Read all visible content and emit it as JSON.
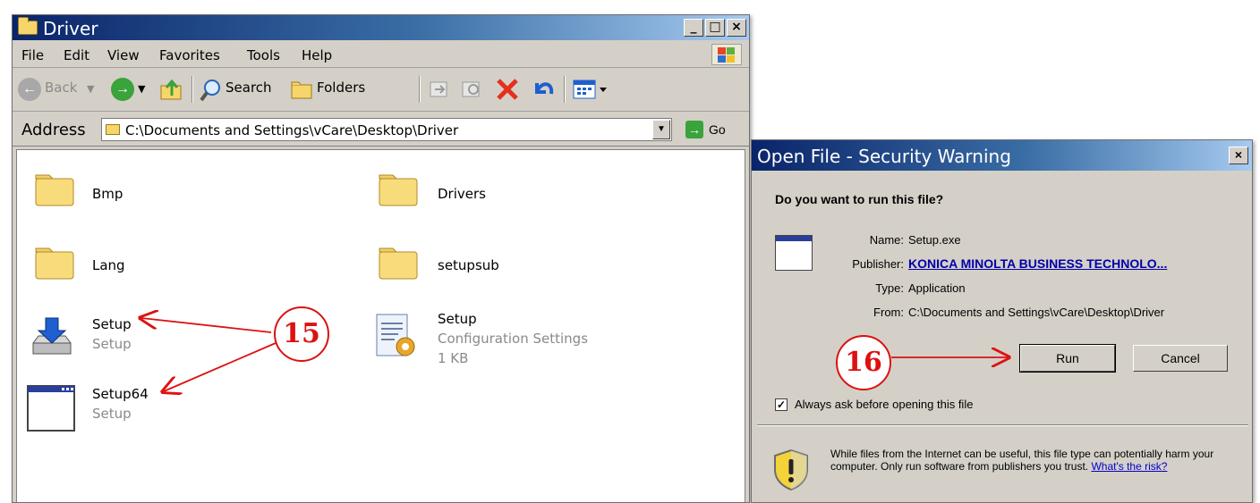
{
  "explorer": {
    "title": "Driver",
    "window_buttons": {
      "minimize": "_",
      "maximize": "□",
      "close": "×"
    },
    "menu": [
      "File",
      "Edit",
      "View",
      "Favorites",
      "Tools",
      "Help"
    ],
    "toolbar": {
      "back_label": "Back",
      "search_label": "Search",
      "folders_label": "Folders"
    },
    "address": {
      "label": "Address",
      "path": "C:\\Documents and Settings\\vCare\\Desktop\\Driver",
      "go_label": "Go"
    },
    "items": [
      {
        "name": "Bmp",
        "icon": "folder-icon"
      },
      {
        "name": "Drivers",
        "icon": "folder-icon"
      },
      {
        "name": "Lang",
        "icon": "folder-icon"
      },
      {
        "name": "setupsub",
        "icon": "folder-icon"
      },
      {
        "name": "Setup",
        "type": "Setup",
        "icon": "installer-icon"
      },
      {
        "name": "Setup",
        "type": "Configuration Settings",
        "size": "1 KB",
        "icon": "config-file-icon"
      },
      {
        "name": "Setup64",
        "type": "Setup",
        "icon": "application-window-icon"
      }
    ]
  },
  "dialog": {
    "title": "Open File - Security Warning",
    "question": "Do you want to run this file?",
    "fields": {
      "name_key": "Name:",
      "name_val": "Setup.exe",
      "publisher_key": "Publisher:",
      "publisher_val": "KONICA MINOLTA BUSINESS TECHNOLO...",
      "type_key": "Type:",
      "type_val": "Application",
      "from_key": "From:",
      "from_val": "C:\\Documents and Settings\\vCare\\Desktop\\Driver"
    },
    "run_label": "Run",
    "cancel_label": "Cancel",
    "checkbox_label": "Always ask before opening this file",
    "checkbox_checked": true,
    "warning_text": "While files from the Internet can be useful, this file type can potentially harm your computer. Only run software from publishers you trust.",
    "warning_link": "What's the risk?"
  },
  "annotations": {
    "step1": "15",
    "step2": "16"
  },
  "colors": {
    "title_gradient_start": "#0a246a",
    "annotation_red": "#dd1111",
    "link_blue": "#0000aa"
  }
}
